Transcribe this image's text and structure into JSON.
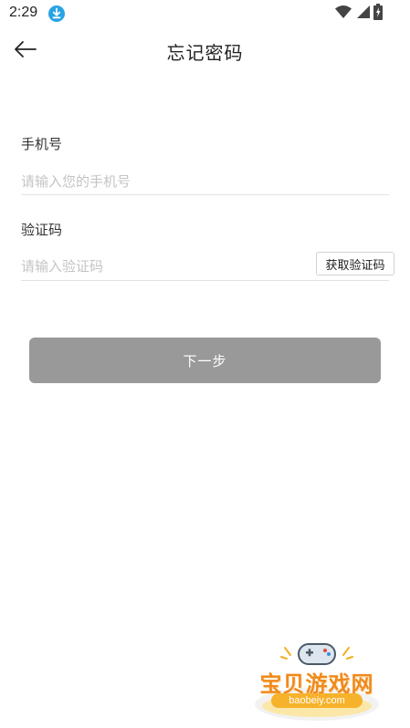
{
  "status_bar": {
    "time": "2:29",
    "icons": [
      "download-icon",
      "wifi-icon",
      "signal-icon",
      "battery-icon"
    ]
  },
  "header": {
    "title": "忘记密码",
    "back_icon": "arrow-left-icon"
  },
  "form": {
    "phone": {
      "label": "手机号",
      "placeholder": "请输入您的手机号",
      "value": ""
    },
    "code": {
      "label": "验证码",
      "placeholder": "请输入验证码",
      "value": "",
      "get_code_label": "获取验证码"
    }
  },
  "next_button": {
    "label": "下一步",
    "color": "#999999"
  },
  "watermark": {
    "title": "宝贝游戏网",
    "url": "baobeiy.com"
  },
  "colors": {
    "accent_download": "#29a3e6",
    "watermark_orange": "#f08a1c"
  }
}
